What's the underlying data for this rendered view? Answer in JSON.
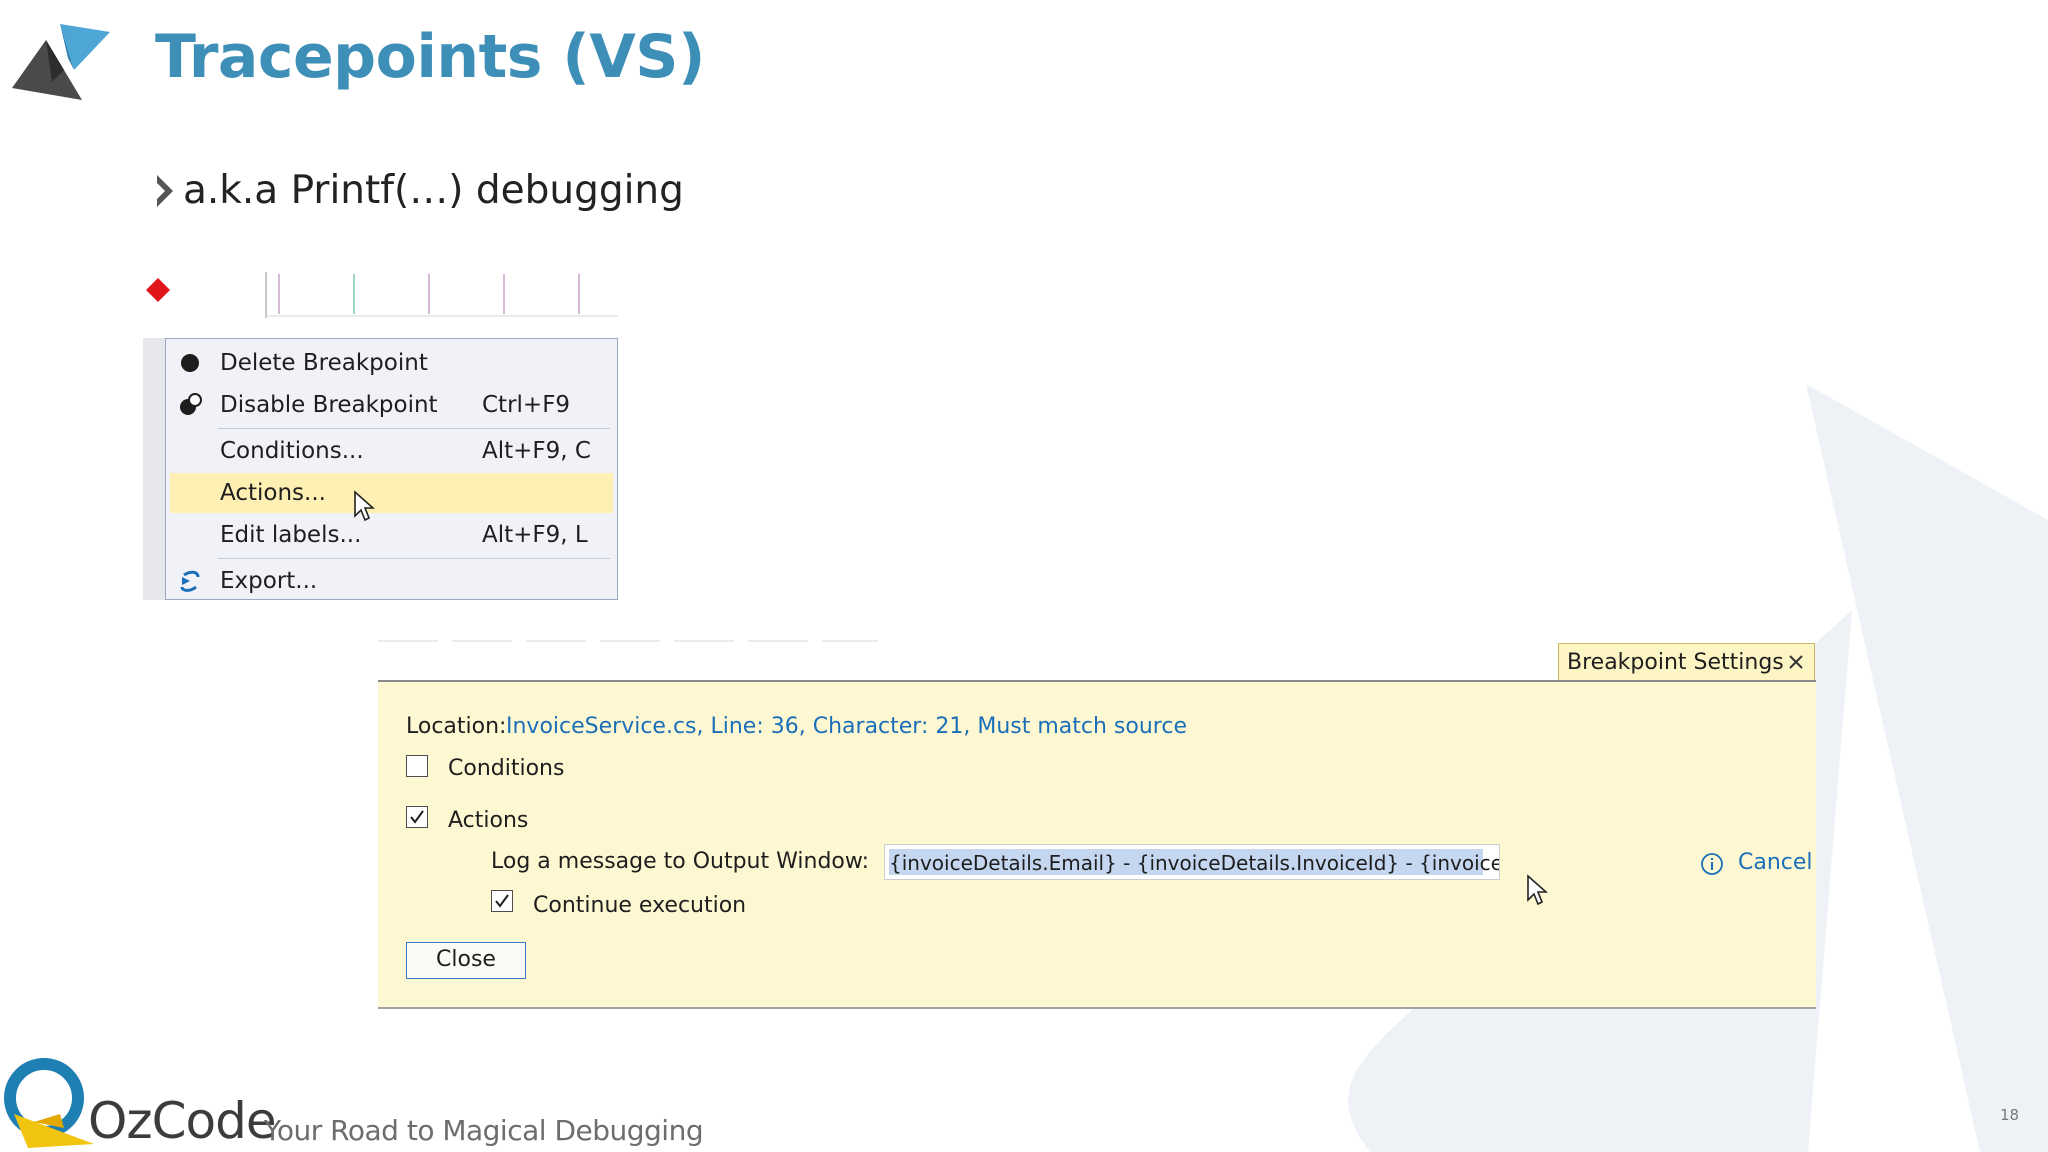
{
  "slide": {
    "title": "Tracepoints (VS)",
    "bullet": "a.k.a Printf(…) debugging",
    "page_number": "18"
  },
  "context_menu": {
    "items": [
      {
        "label": "Delete Breakpoint",
        "shortcut": "",
        "icon": "filled-circle-icon"
      },
      {
        "label": "Disable Breakpoint",
        "shortcut": "Ctrl+F9",
        "icon": "disable-breakpoint-icon"
      },
      {
        "label": "Conditions...",
        "shortcut": "Alt+F9, C",
        "icon": ""
      },
      {
        "label": "Actions...",
        "shortcut": "",
        "icon": "",
        "highlighted": true
      },
      {
        "label": "Edit labels...",
        "shortcut": "Alt+F9, L",
        "icon": ""
      },
      {
        "label": "Export...",
        "shortcut": "",
        "icon": "export-arrow-icon"
      }
    ]
  },
  "breakpoint_settings": {
    "tab_title": "Breakpoint Settings",
    "location_label": "Location:",
    "location_value": "InvoiceService.cs, Line: 36, Character: 21, Must match source",
    "conditions_label": "Conditions",
    "conditions_checked": false,
    "actions_label": "Actions",
    "actions_checked": true,
    "log_label": "Log a message to Output Window:",
    "log_value": "{invoiceDetails.Email} - {invoiceDetails.InvoiceId} - {invoiceDetails.IsValid}",
    "cancel_label": "Cancel",
    "continue_label": "Continue execution",
    "continue_checked": true,
    "close_label": "Close"
  },
  "footer": {
    "brand": "OzCode",
    "tagline": "Your Road to Magical Debugging"
  },
  "colors": {
    "title": "#3d8fb8",
    "panel_bg": "#fdf7d2",
    "link": "#1a6fb8",
    "breakpoint_red": "#e0151b",
    "menu_highlight": "#fdf0b2"
  }
}
